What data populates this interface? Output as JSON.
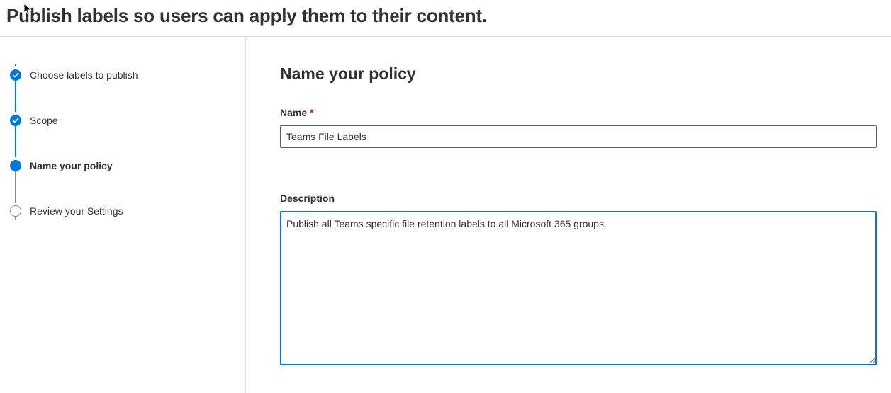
{
  "header": {
    "title": "Publish labels so users can apply them to their content."
  },
  "wizard": {
    "steps": [
      {
        "label": "Choose labels to publish",
        "state": "completed"
      },
      {
        "label": "Scope",
        "state": "completed"
      },
      {
        "label": "Name your policy",
        "state": "current"
      },
      {
        "label": "Review your Settings",
        "state": "not-started"
      }
    ]
  },
  "form": {
    "title": "Name your policy",
    "name_label": "Name",
    "required_marker": "*",
    "name_value": "Teams File Labels",
    "description_label": "Description",
    "description_value": "Publish all Teams specific file retention labels to all Microsoft 365 groups."
  },
  "colors": {
    "accent": "#0078d4",
    "required": "#a4262c",
    "inactive": "#8a8886"
  },
  "icons": {
    "completed": "checkmark-icon",
    "current": "current-step-dot-icon",
    "not_started": "empty-circle-icon",
    "cursor": "mouse-pointer-icon"
  }
}
